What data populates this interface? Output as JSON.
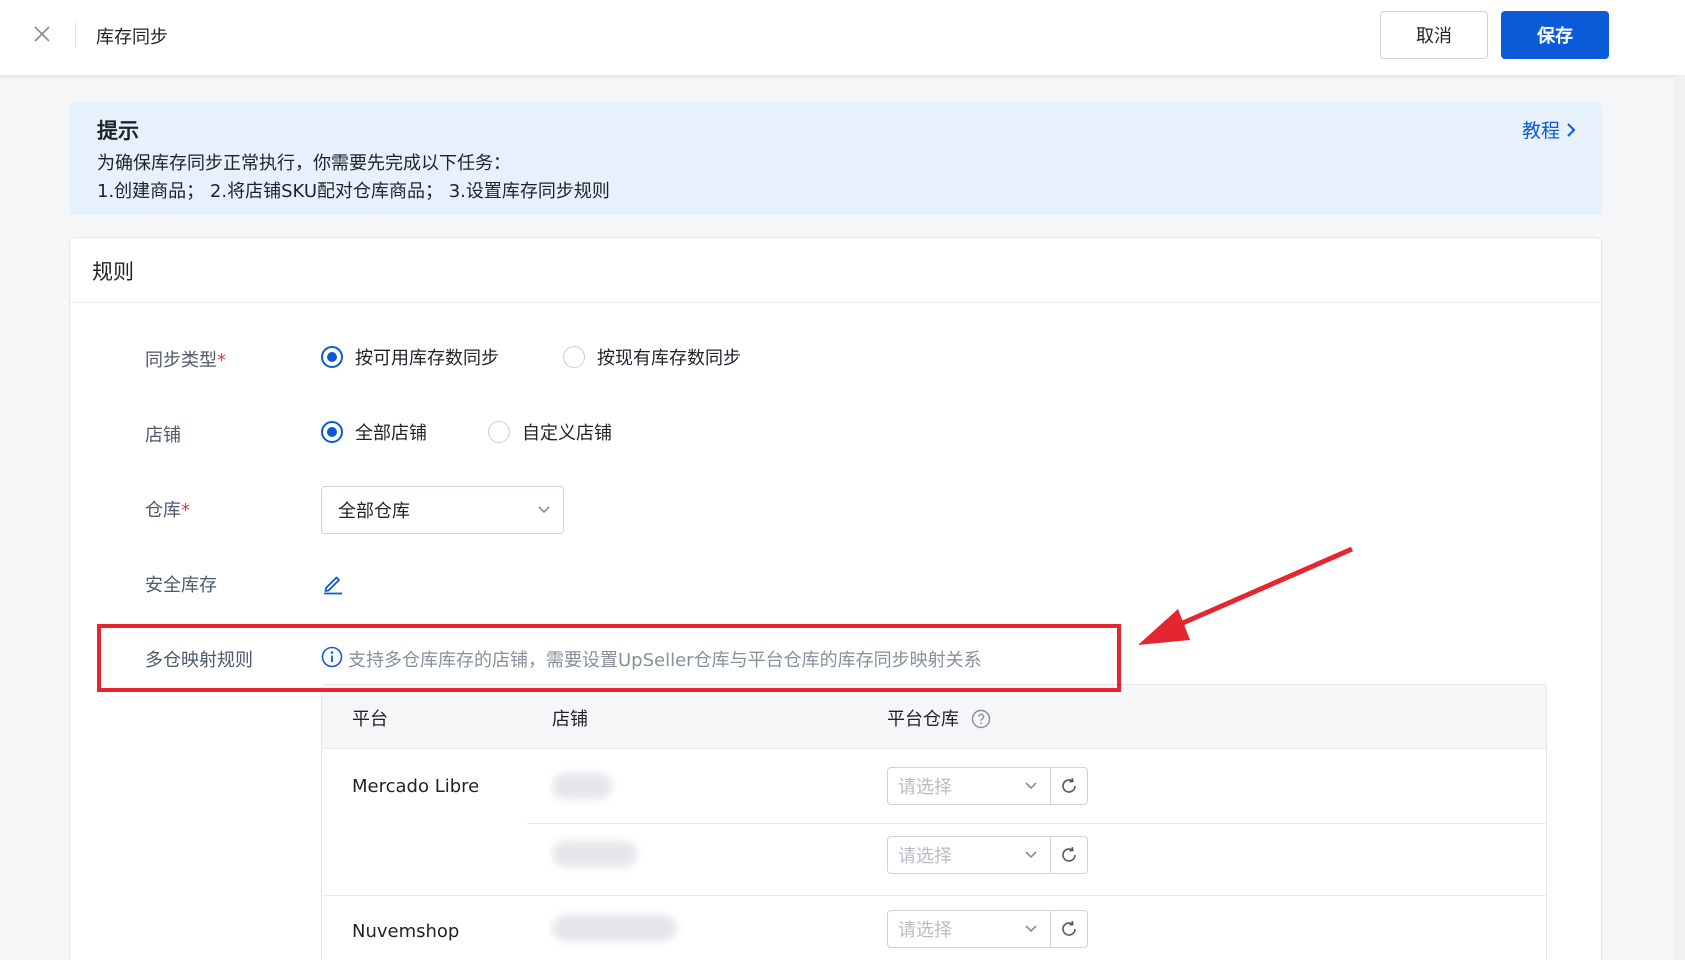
{
  "header": {
    "close_icon": "close-icon",
    "title": "库存同步",
    "cancel_label": "取消",
    "save_label": "保存"
  },
  "tip": {
    "title": "提示",
    "line1": "为确保库存同步正常执行，你需要先完成以下任务：",
    "line2": "1.创建商品； 2.将店铺SKU配对仓库商品； 3.设置库存同步规则",
    "link_label": "教程",
    "link_icon": "chevron-right-icon"
  },
  "rules": {
    "title": "规则",
    "sync_type": {
      "label": "同步类型",
      "required_mark": "*",
      "options": [
        {
          "label": "按可用库存数同步",
          "checked": true
        },
        {
          "label": "按现有库存数同步",
          "checked": false
        }
      ]
    },
    "store": {
      "label": "店铺",
      "options": [
        {
          "label": "全部店铺",
          "checked": true
        },
        {
          "label": "自定义店铺",
          "checked": false
        }
      ]
    },
    "warehouse": {
      "label": "仓库",
      "required_mark": "*",
      "selected": "全部仓库"
    },
    "safety_stock": {
      "label": "安全库存",
      "icon": "edit-icon"
    },
    "multi_warehouse": {
      "label": "多仓映射规则",
      "info_icon": "info-icon",
      "info_text": "支持多仓库库存的店铺，需要设置UpSeller仓库与平台仓库的库存同步映射关系"
    },
    "mapping_table": {
      "headers": [
        "平台",
        "店铺",
        "平台仓库"
      ],
      "header_help_icon": "question-circle-icon",
      "rows": [
        {
          "platform": "Mercado Libre",
          "select_placeholder": "请选择"
        },
        {
          "platform": "",
          "select_placeholder": "请选择"
        },
        {
          "platform": "Nuvemshop",
          "select_placeholder": "请选择"
        }
      ]
    }
  },
  "colors": {
    "primary": "#0b5bd9",
    "tip_bg": "#e6f1fc",
    "highlight": "#e5262e"
  }
}
